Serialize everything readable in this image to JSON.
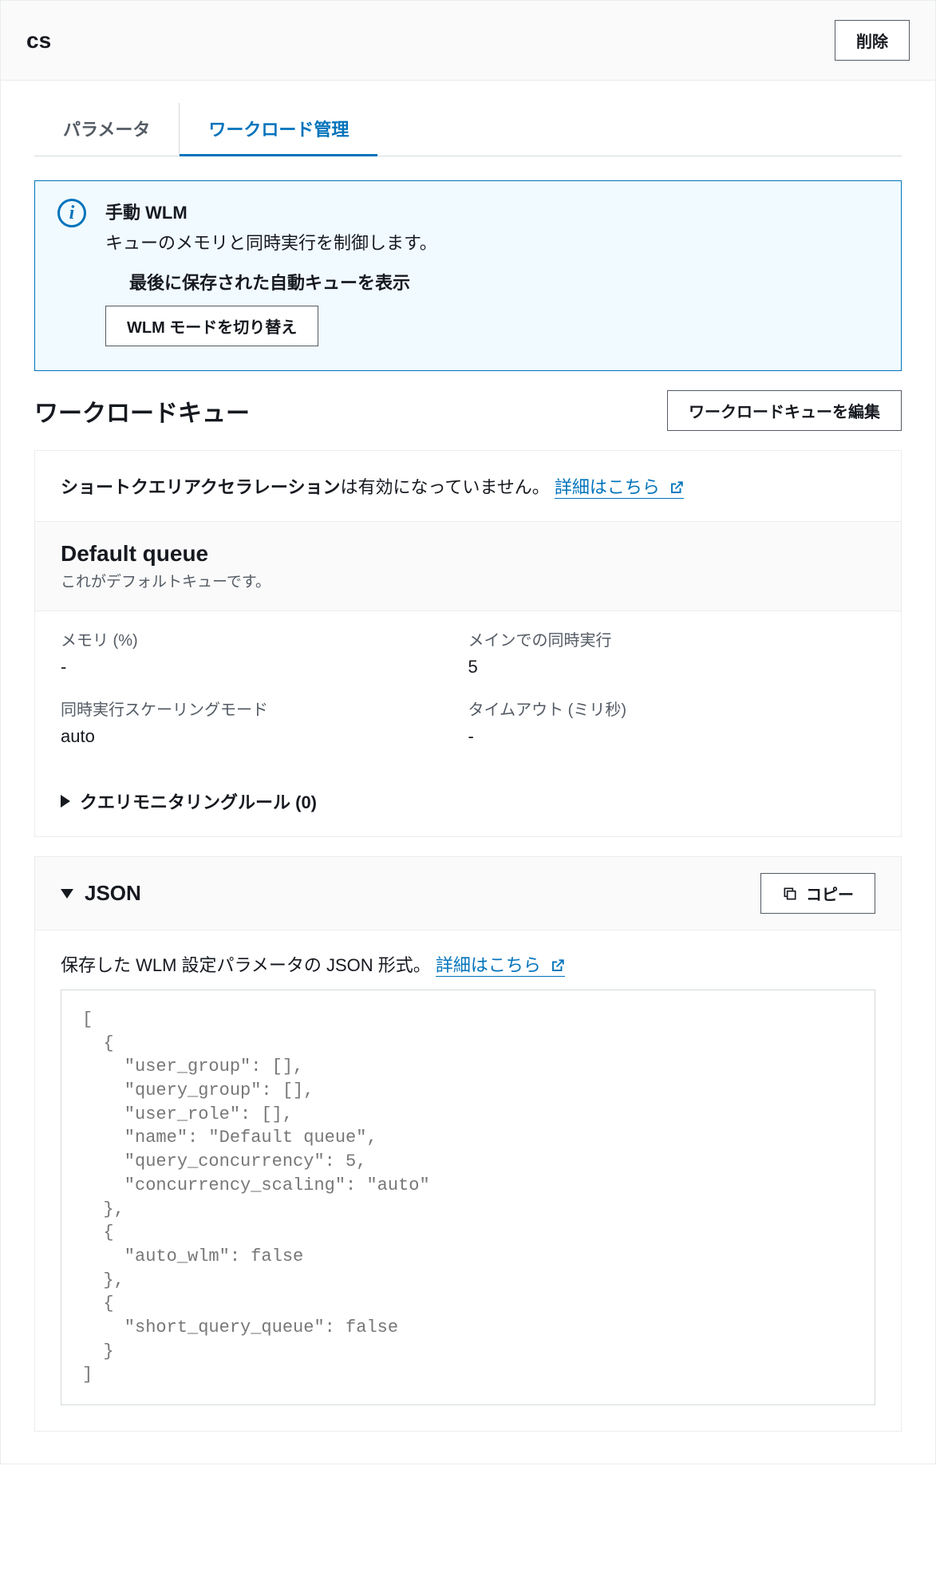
{
  "header": {
    "title": "cs",
    "delete_label": "削除"
  },
  "tabs": {
    "parameters": "パラメータ",
    "wlm": "ワークロード管理"
  },
  "info": {
    "title": "手動 WLM",
    "desc": "キューのメモリと同時実行を制御します。",
    "sub": "最後に保存された自動キューを表示",
    "switch_label": "WLM モードを切り替え"
  },
  "workload": {
    "title": "ワークロードキュー",
    "edit_label": "ワークロードキューを編集"
  },
  "sqa": {
    "label": "ショートクエリアクセラレーション",
    "status": "は有効になっていません。",
    "link": "詳細はこちら"
  },
  "queue": {
    "title": "Default queue",
    "sub": "これがデフォルトキューです。",
    "props": {
      "memory_label": "メモリ (%)",
      "memory_value": "-",
      "concurrency_label": "メインでの同時実行",
      "concurrency_value": "5",
      "scaling_label": "同時実行スケーリングモード",
      "scaling_value": "auto",
      "timeout_label": "タイムアウト (ミリ秒)",
      "timeout_value": "-"
    },
    "rules_label": "クエリモニタリングルール (0)"
  },
  "json": {
    "title": "JSON",
    "copy_label": "コピー",
    "desc_prefix": "保存した WLM 設定パラメータの JSON 形式。",
    "link": "詳細はこちら",
    "code": "[\n  {\n    \"user_group\": [],\n    \"query_group\": [],\n    \"user_role\": [],\n    \"name\": \"Default queue\",\n    \"query_concurrency\": 5,\n    \"concurrency_scaling\": \"auto\"\n  },\n  {\n    \"auto_wlm\": false\n  },\n  {\n    \"short_query_queue\": false\n  }\n]"
  }
}
